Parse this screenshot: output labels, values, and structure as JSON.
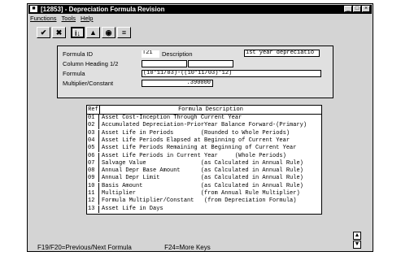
{
  "window": {
    "title": "[12853] - Depreciation Formula Revision",
    "sys_icon": "■",
    "buttons": {
      "minimize": "_",
      "maximize": "□",
      "close": "×"
    }
  },
  "menu": [
    "Functions",
    "Tools",
    "Help"
  ],
  "toolbar": {
    "buttons": [
      {
        "name": "check-icon",
        "glyph": "✔"
      },
      {
        "name": "cancel-icon",
        "glyph": "✖"
      },
      {
        "name": "inquire-icon",
        "glyph": "i↓"
      },
      {
        "name": "mountain-icon",
        "glyph": "▲"
      },
      {
        "name": "target-icon",
        "glyph": "◉"
      },
      {
        "name": "list-icon",
        "glyph": "≡"
      }
    ]
  },
  "form": {
    "formula_id_label": "Formula ID",
    "formula_id_value": "T21",
    "description_label": "Description",
    "description_value": "1st year depreciatio",
    "column_heading_label": "Column Heading 1/2",
    "column_heading_1": "",
    "column_heading_2": "",
    "formula_label": "Formula",
    "formula_value": "(10*11/03)-((10*11/03)*12)",
    "multiplier_label": "Multiplier/Constant",
    "multiplier_value": ".390000"
  },
  "grid": {
    "col_ref": "Ref",
    "col_desc": "Formula Description",
    "rows": [
      {
        "ref": "01",
        "desc": "Asset Cost-Inception Through Current Year"
      },
      {
        "ref": "02",
        "desc": "Accumulated Depreciation-PriorYear Balance Forward-(Primary)"
      },
      {
        "ref": "03",
        "desc": "Asset Life in Periods        (Rounded to Whole Periods)"
      },
      {
        "ref": "04",
        "desc": "Asset Life Periods Elapsed at Beginning of Current Year"
      },
      {
        "ref": "05",
        "desc": "Asset Life Periods Remaining at Beginning of Current Year"
      },
      {
        "ref": "06",
        "desc": "Asset Life Periods in Current Year     (Whole Periods)"
      },
      {
        "ref": "07",
        "desc": "Salvage Value                (as Calculated in Annual Rule)"
      },
      {
        "ref": "08",
        "desc": "Annual Depr Base Amount      (as Calculated in Annual Rule)"
      },
      {
        "ref": "09",
        "desc": "Annual Depr Limit            (as Calculated in Annual Rule)"
      },
      {
        "ref": "10",
        "desc": "Basis Amount                 (as Calculated in Annual Rule)"
      },
      {
        "ref": "11",
        "desc": "Multiplier                   (from Annual Rule Multiplier)"
      },
      {
        "ref": "12",
        "desc": "Formula Multiplier/Constant   (from Depreciation Formula)"
      },
      {
        "ref": "13",
        "desc": "Asset Life in Days"
      }
    ]
  },
  "status": {
    "prev_next": "F19/F20=Previous/Next Formula",
    "more_keys": "F24=More Keys"
  },
  "scroll": {
    "up": "▲",
    "down": "▼"
  }
}
